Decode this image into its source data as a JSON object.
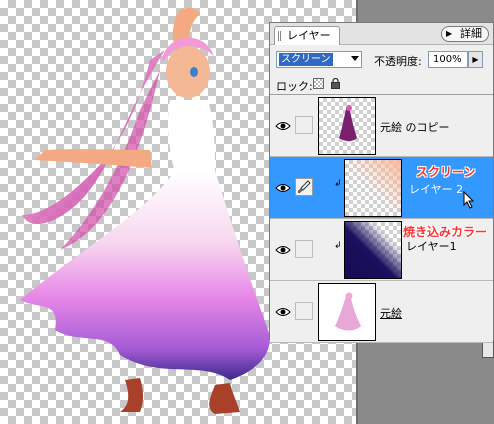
{
  "panel": {
    "tab_label": "レイヤー",
    "detail_button": "詳細",
    "blend_mode": "スクリーン",
    "opacity_label": "不透明度:",
    "opacity_value": "100%",
    "lock_label": "ロック:"
  },
  "layers": [
    {
      "name": "元絵 のコピー",
      "visible": true,
      "selected": false
    },
    {
      "name": "レイヤー 2",
      "visible": true,
      "selected": true,
      "clipped": true,
      "annotation": "スクリーン"
    },
    {
      "name": "レイヤー1",
      "visible": true,
      "selected": false,
      "clipped": true,
      "annotation": "焼き込みカラー"
    },
    {
      "name": "元絵",
      "visible": true,
      "selected": false,
      "underlined": true
    }
  ],
  "colors": {
    "selection": "#3399ff",
    "annotation": "#ff3333",
    "dress_gradient_top": "#ffffff",
    "dress_gradient_bottom": "#3a2a8a",
    "hair": "#f08ccf",
    "skin": "#f5a982"
  },
  "icons": [
    "eye-icon",
    "brush-icon",
    "lock-icon",
    "checkerboard-lock-icon",
    "clip-arrow-icon",
    "mouse-cursor-icon",
    "detail-icon"
  ]
}
